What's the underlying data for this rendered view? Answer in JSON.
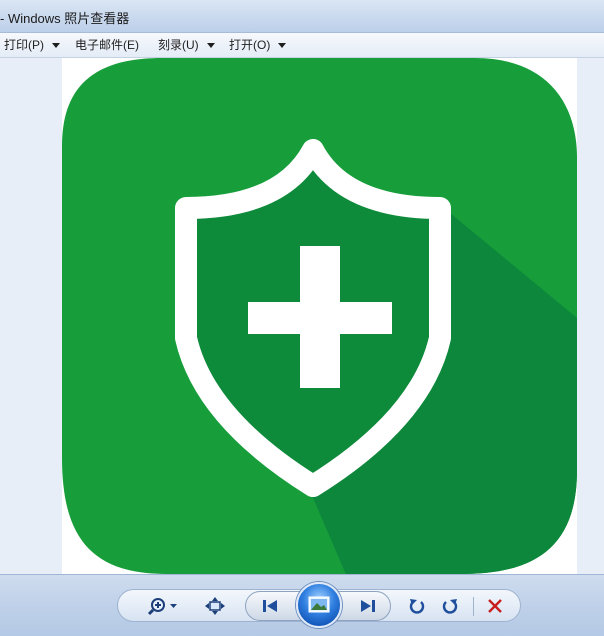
{
  "window": {
    "title": "- Windows 照片查看器"
  },
  "menubar": {
    "items": [
      {
        "label": "打印(P)",
        "has_dropdown": true
      },
      {
        "label": "电子邮件(E)",
        "has_dropdown": false
      },
      {
        "label": "刻录(U)",
        "has_dropdown": true
      },
      {
        "label": "打开(O)",
        "has_dropdown": true
      }
    ]
  },
  "image": {
    "subject": "green shield with white cross app icon",
    "colors": {
      "background": "#179E3B",
      "shield_fill": "#0D8A3A",
      "shadow": "#0D873B",
      "outline": "#FFFFFF"
    }
  },
  "toolbar": {
    "buttons": [
      {
        "icon": "zoom-icon"
      },
      {
        "icon": "actual-size-icon"
      },
      {
        "icon": "previous-icon"
      },
      {
        "icon": "slideshow-icon"
      },
      {
        "icon": "next-icon"
      },
      {
        "icon": "rotate-counterclockwise-icon"
      },
      {
        "icon": "rotate-clockwise-icon"
      },
      {
        "icon": "delete-icon"
      }
    ]
  }
}
